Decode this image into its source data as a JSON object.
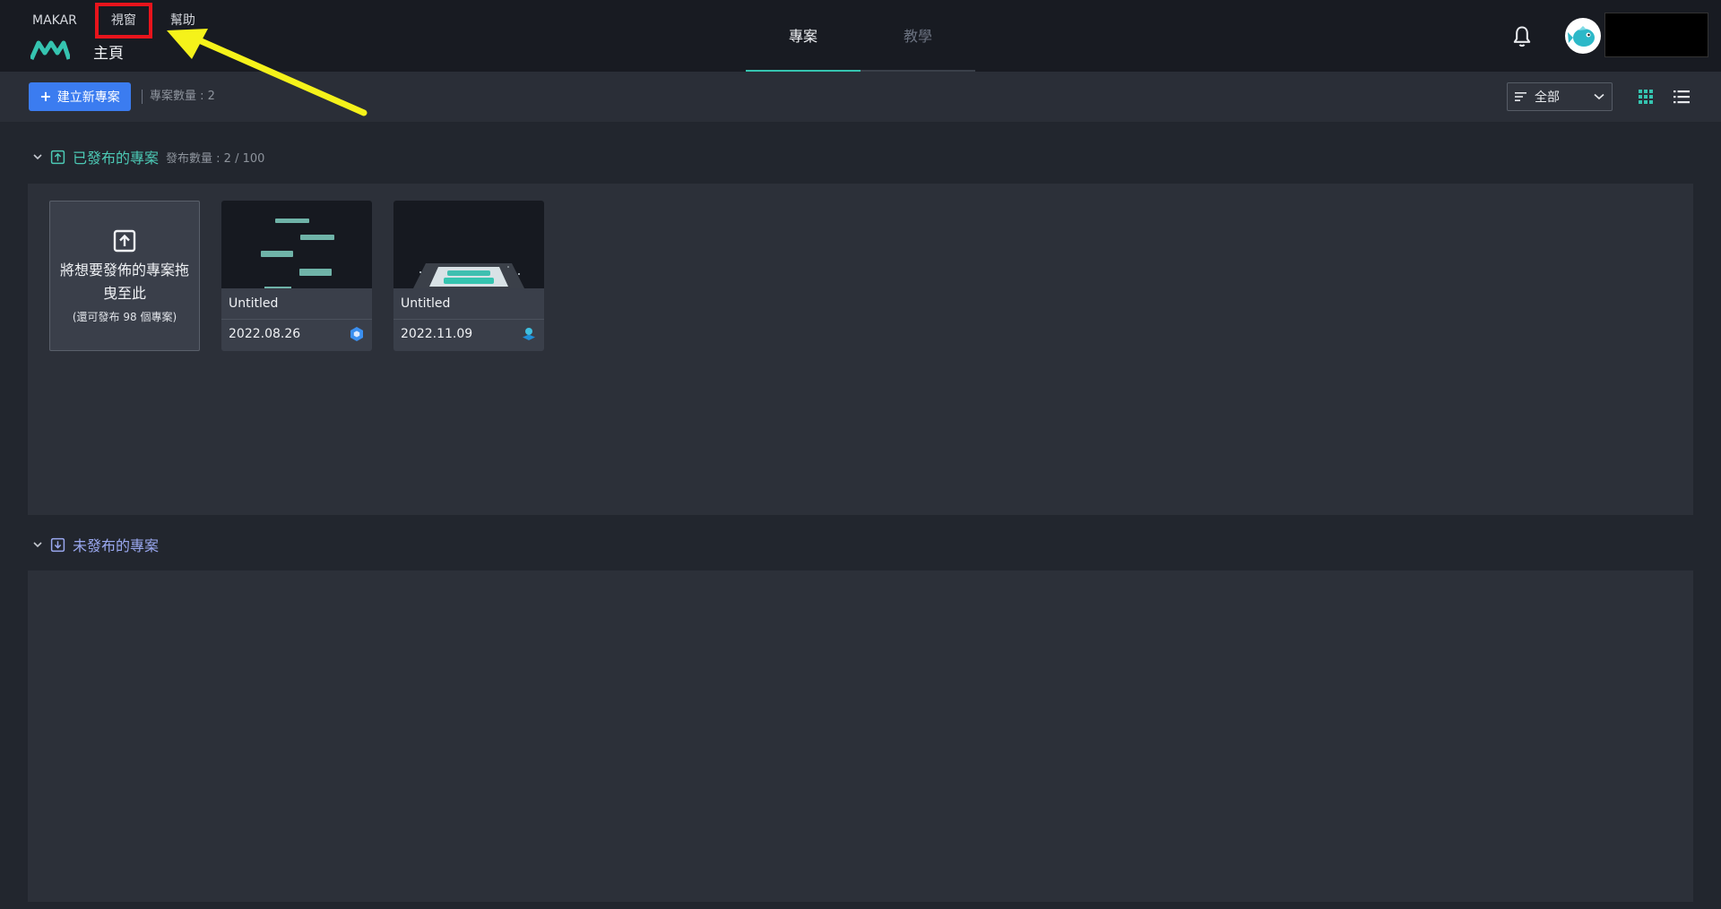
{
  "menu": {
    "items": [
      "MAKAR",
      "視窗",
      "幫助"
    ]
  },
  "header": {
    "page_title": "主頁"
  },
  "tabs": [
    {
      "label": "專案",
      "active": true
    },
    {
      "label": "教學",
      "active": false
    }
  ],
  "toolbar": {
    "new_project_label": "建立新專案",
    "project_count": "專案數量 : 2",
    "filter_value": "全部"
  },
  "published": {
    "title": "已發布的專案",
    "count": "發布數量 : 2 / 100",
    "dropzone_title": "將想要發佈的專案拖曳至此",
    "dropzone_sub": "(還可發布 98 個專案)",
    "projects": [
      {
        "name": "Untitled",
        "date": "2022.08.26",
        "badge_icon": "hexagon-badge-icon"
      },
      {
        "name": "Untitled",
        "date": "2022.11.09",
        "badge_icon": "ar-cube-badge-icon"
      }
    ]
  },
  "unpublished": {
    "title": "未發布的專案"
  },
  "colors": {
    "accent": "#35c4b0",
    "primary_button": "#3b7cf0",
    "highlight_box": "#e8141c",
    "annotation_arrow": "#f5f21a"
  }
}
